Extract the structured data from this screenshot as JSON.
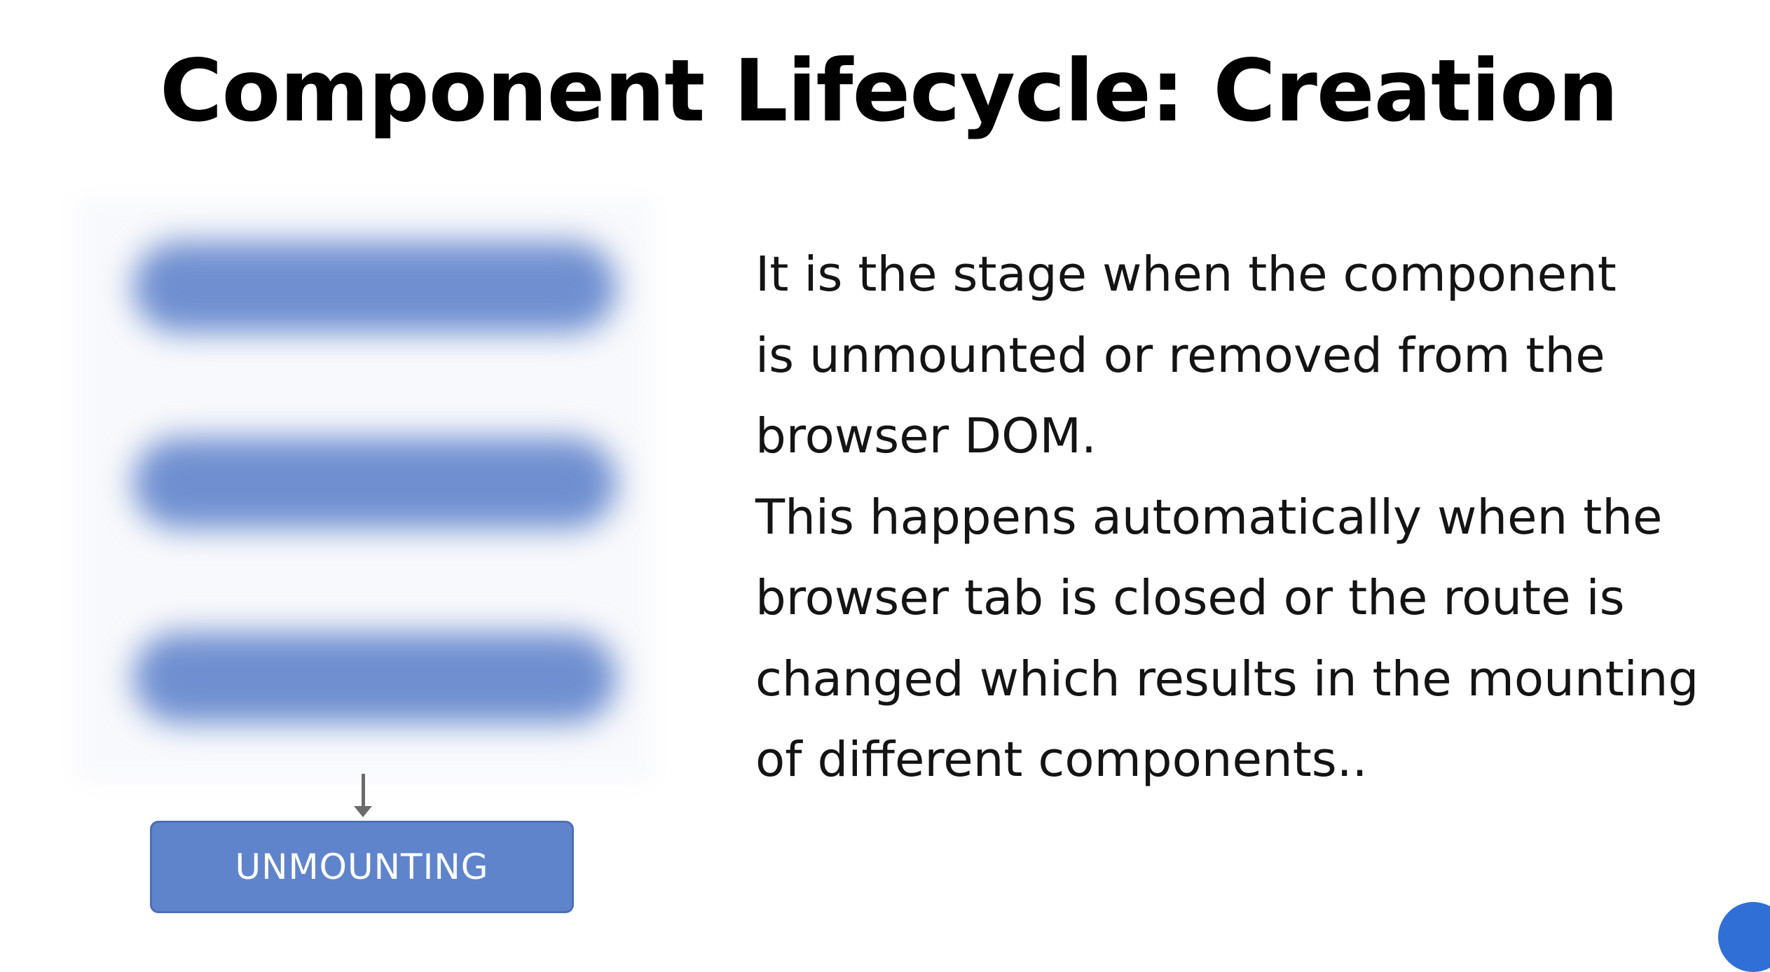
{
  "slide": {
    "title": "Component Lifecycle: Creation"
  },
  "diagram": {
    "stage_label": "UNMOUNTING",
    "accent_color": "#5f84cb",
    "blurred_stage_color": "#6f8fd0",
    "connector_color": "#6b6b6b"
  },
  "description": {
    "lines": [
      "It is the stage when the component",
      "is unmounted or removed from the",
      "browser DOM.",
      "This happens automatically when the",
      "browser tab is closed or the route is",
      "changed which results in the mounting",
      "of different components.."
    ]
  },
  "corner_badge": {
    "color": "#2f6fd6"
  }
}
